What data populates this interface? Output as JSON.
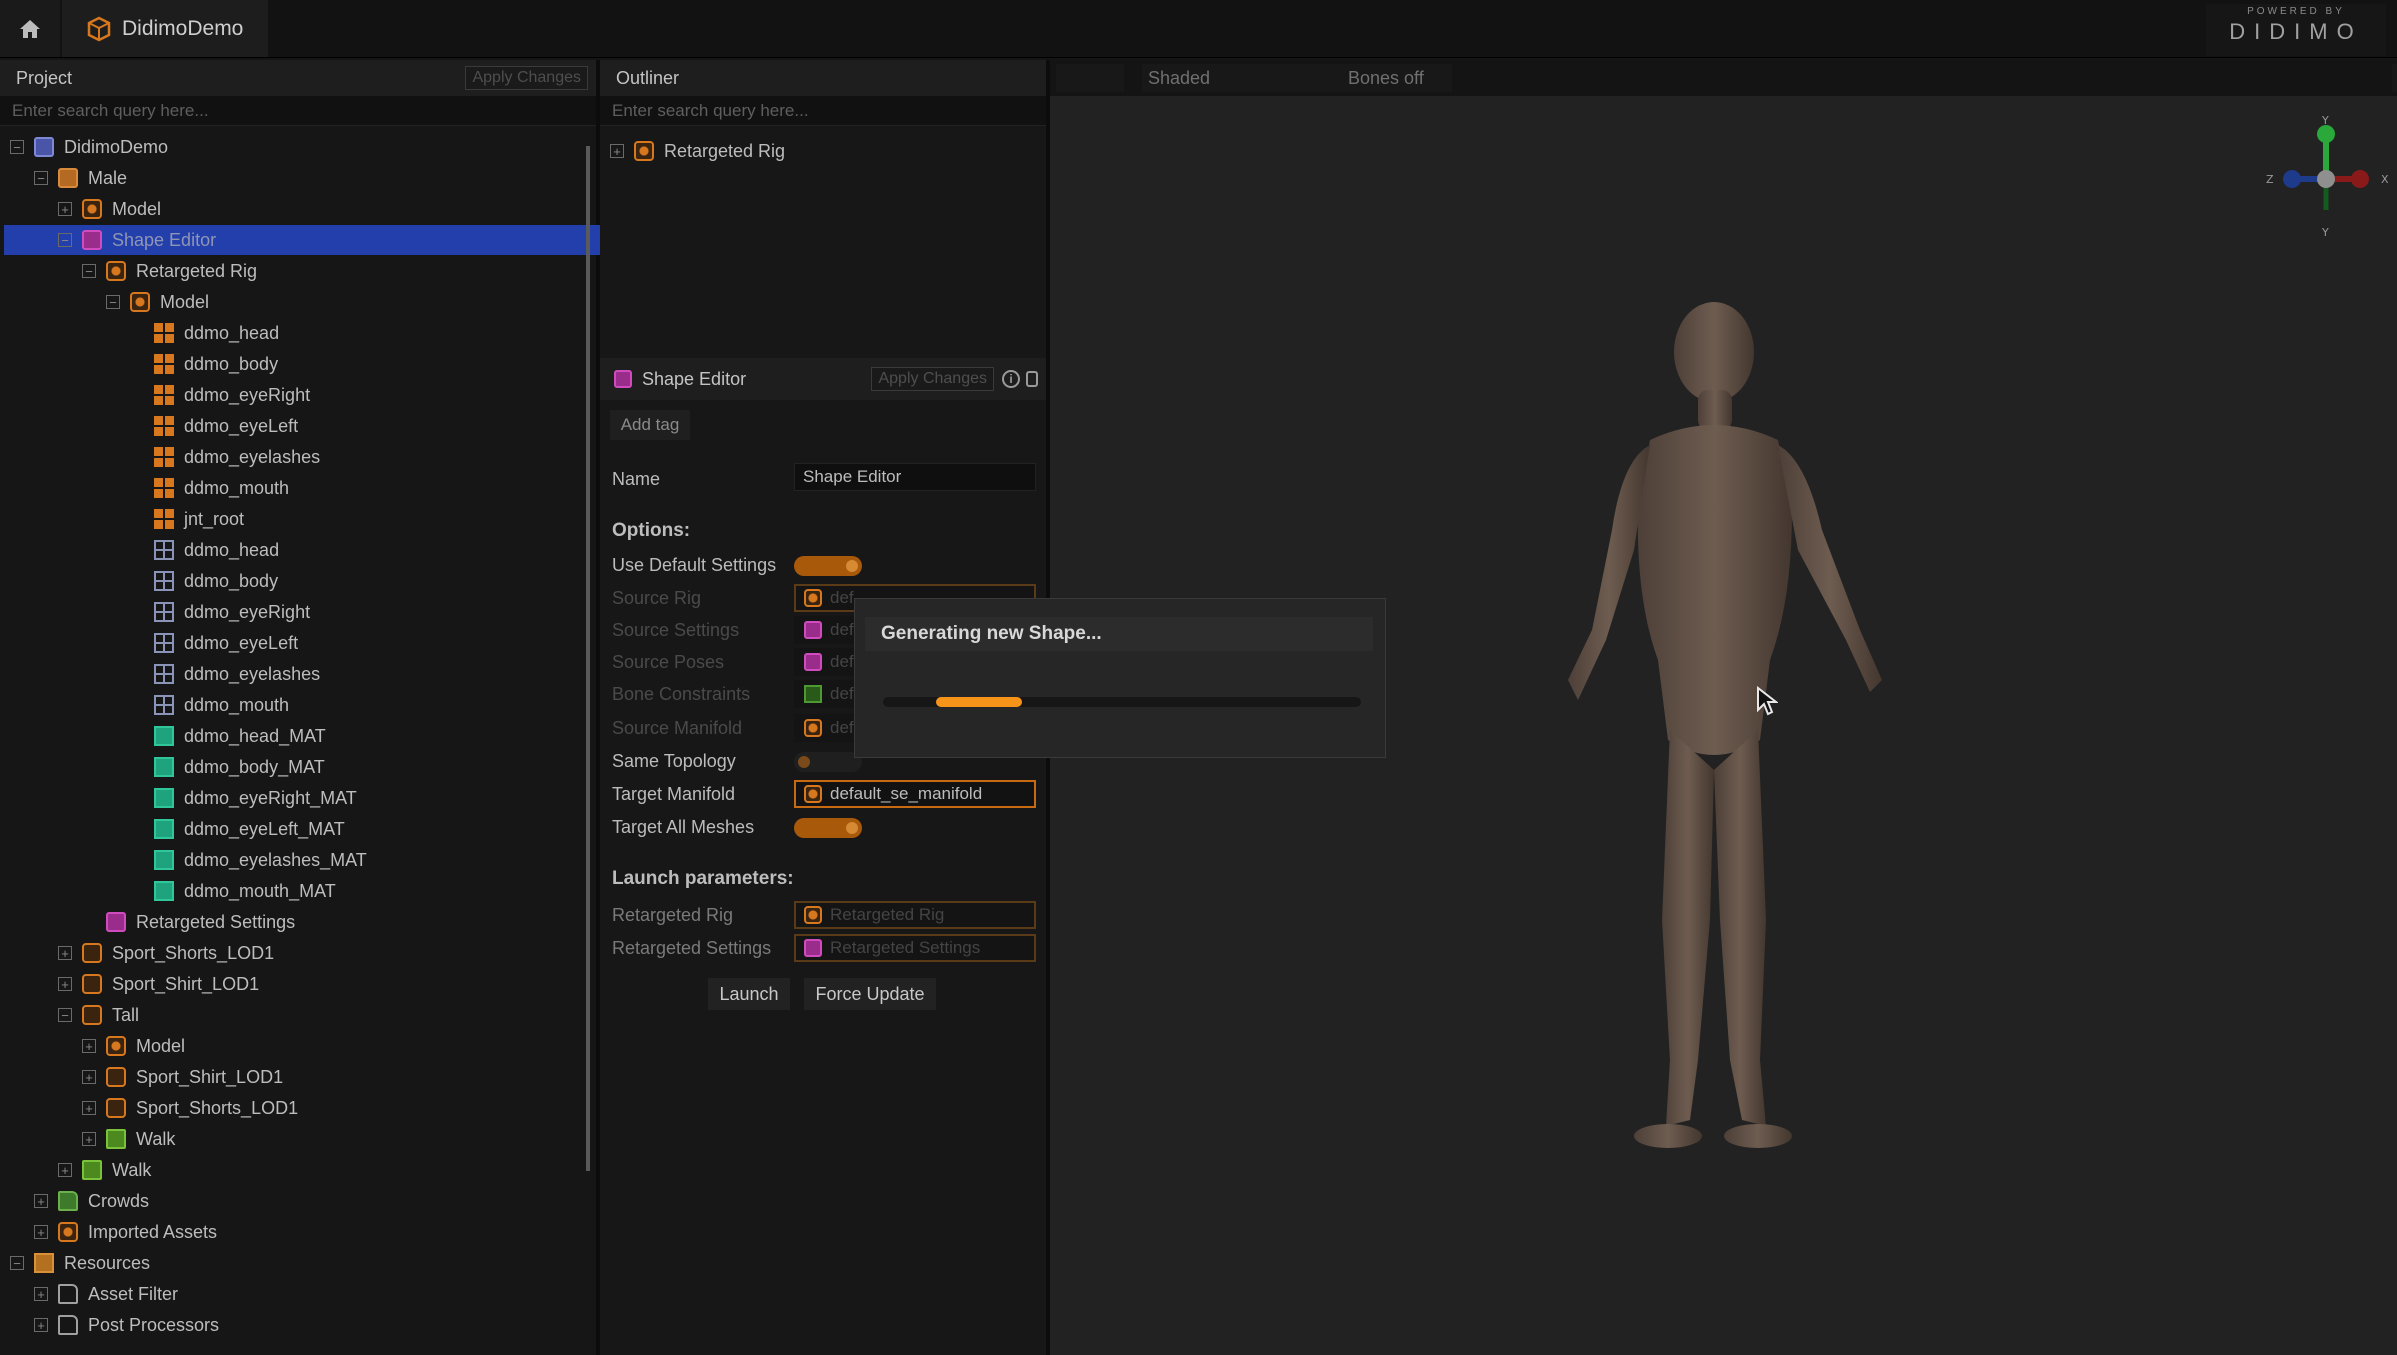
{
  "app": {
    "title": "DidimoDemo",
    "logo_top": "POWERED BY",
    "logo_main": "DIDIMO"
  },
  "project": {
    "title": "Project",
    "apply_label": "Apply Changes",
    "search_placeholder": "Enter search query here...",
    "tree": [
      {
        "label": "DidimoDemo",
        "indent": 0,
        "exp": "-",
        "icon": "ic-pb",
        "icon_name": "project-icon"
      },
      {
        "label": "Male",
        "indent": 1,
        "exp": "-",
        "icon": "ic-face",
        "icon_name": "character-icon"
      },
      {
        "label": "Model",
        "indent": 2,
        "exp": "+",
        "icon": "ic-orange-c",
        "icon_name": "model-icon"
      },
      {
        "label": "Shape Editor",
        "indent": 2,
        "exp": "-",
        "icon": "ic-pink",
        "icon_name": "shape-editor-icon",
        "selected": true
      },
      {
        "label": "Retargeted Rig",
        "indent": 3,
        "exp": "-",
        "icon": "ic-orange-c",
        "icon_name": "rig-icon"
      },
      {
        "label": "Model",
        "indent": 4,
        "exp": "-",
        "icon": "ic-orange-c",
        "icon_name": "model-icon"
      },
      {
        "label": "ddmo_head",
        "indent": 5,
        "exp": "",
        "icon": "ic-grid-o",
        "icon_name": "mesh-icon"
      },
      {
        "label": "ddmo_body",
        "indent": 5,
        "exp": "",
        "icon": "ic-grid-o",
        "icon_name": "mesh-icon"
      },
      {
        "label": "ddmo_eyeRight",
        "indent": 5,
        "exp": "",
        "icon": "ic-grid-o",
        "icon_name": "mesh-icon"
      },
      {
        "label": "ddmo_eyeLeft",
        "indent": 5,
        "exp": "",
        "icon": "ic-grid-o",
        "icon_name": "mesh-icon"
      },
      {
        "label": "ddmo_eyelashes",
        "indent": 5,
        "exp": "",
        "icon": "ic-grid-o",
        "icon_name": "mesh-icon"
      },
      {
        "label": "ddmo_mouth",
        "indent": 5,
        "exp": "",
        "icon": "ic-grid-o",
        "icon_name": "mesh-icon"
      },
      {
        "label": "jnt_root",
        "indent": 5,
        "exp": "",
        "icon": "ic-grid-o",
        "icon_name": "joint-icon"
      },
      {
        "label": "ddmo_head",
        "indent": 5,
        "exp": "",
        "icon": "ic-grid-b",
        "icon_name": "geometry-icon"
      },
      {
        "label": "ddmo_body",
        "indent": 5,
        "exp": "",
        "icon": "ic-grid-b",
        "icon_name": "geometry-icon"
      },
      {
        "label": "ddmo_eyeRight",
        "indent": 5,
        "exp": "",
        "icon": "ic-grid-b",
        "icon_name": "geometry-icon"
      },
      {
        "label": "ddmo_eyeLeft",
        "indent": 5,
        "exp": "",
        "icon": "ic-grid-b",
        "icon_name": "geometry-icon"
      },
      {
        "label": "ddmo_eyelashes",
        "indent": 5,
        "exp": "",
        "icon": "ic-grid-b",
        "icon_name": "geometry-icon"
      },
      {
        "label": "ddmo_mouth",
        "indent": 5,
        "exp": "",
        "icon": "ic-grid-b",
        "icon_name": "geometry-icon"
      },
      {
        "label": "ddmo_head_MAT",
        "indent": 5,
        "exp": "",
        "icon": "ic-mat",
        "icon_name": "material-icon"
      },
      {
        "label": "ddmo_body_MAT",
        "indent": 5,
        "exp": "",
        "icon": "ic-mat",
        "icon_name": "material-icon"
      },
      {
        "label": "ddmo_eyeRight_MAT",
        "indent": 5,
        "exp": "",
        "icon": "ic-mat",
        "icon_name": "material-icon"
      },
      {
        "label": "ddmo_eyeLeft_MAT",
        "indent": 5,
        "exp": "",
        "icon": "ic-mat",
        "icon_name": "material-icon"
      },
      {
        "label": "ddmo_eyelashes_MAT",
        "indent": 5,
        "exp": "",
        "icon": "ic-mat",
        "icon_name": "material-icon"
      },
      {
        "label": "ddmo_mouth_MAT",
        "indent": 5,
        "exp": "",
        "icon": "ic-mat",
        "icon_name": "material-icon"
      },
      {
        "label": "Retargeted Settings",
        "indent": 3,
        "exp": "",
        "icon": "ic-pink",
        "icon_name": "settings-icon"
      },
      {
        "label": "Sport_Shorts_LOD1",
        "indent": 2,
        "exp": "+",
        "icon": "ic-orange",
        "icon_name": "clothing-icon"
      },
      {
        "label": "Sport_Shirt_LOD1",
        "indent": 2,
        "exp": "+",
        "icon": "ic-orange",
        "icon_name": "clothing-icon"
      },
      {
        "label": "Tall",
        "indent": 2,
        "exp": "-",
        "icon": "ic-orange",
        "icon_name": "variant-icon"
      },
      {
        "label": "Model",
        "indent": 3,
        "exp": "+",
        "icon": "ic-orange-c",
        "icon_name": "model-icon"
      },
      {
        "label": "Sport_Shirt_LOD1",
        "indent": 3,
        "exp": "+",
        "icon": "ic-orange",
        "icon_name": "clothing-icon"
      },
      {
        "label": "Sport_Shorts_LOD1",
        "indent": 3,
        "exp": "+",
        "icon": "ic-orange",
        "icon_name": "clothing-icon"
      },
      {
        "label": "Walk",
        "indent": 3,
        "exp": "+",
        "icon": "ic-green",
        "icon_name": "animation-icon"
      },
      {
        "label": "Walk",
        "indent": 2,
        "exp": "+",
        "icon": "ic-green",
        "icon_name": "animation-icon"
      },
      {
        "label": "Crowds",
        "indent": 1,
        "exp": "+",
        "icon": "ic-folder-g",
        "icon_name": "folder-icon"
      },
      {
        "label": "Imported Assets",
        "indent": 1,
        "exp": "+",
        "icon": "ic-orange-c",
        "icon_name": "imported-assets-icon"
      },
      {
        "label": "Resources",
        "indent": 0,
        "exp": "-",
        "icon": "ic-res",
        "icon_name": "resources-icon"
      },
      {
        "label": "Asset Filter",
        "indent": 1,
        "exp": "+",
        "icon": "ic-folder",
        "icon_name": "folder-icon"
      },
      {
        "label": "Post Processors",
        "indent": 1,
        "exp": "+",
        "icon": "ic-folder",
        "icon_name": "folder-icon"
      }
    ]
  },
  "outliner": {
    "title": "Outliner",
    "search_placeholder": "Enter search query here...",
    "item": "Retargeted Rig"
  },
  "inspector": {
    "title": "Shape Editor",
    "apply_label": "Apply Changes",
    "add_tag": "Add tag",
    "name_label": "Name",
    "name_value": "Shape Editor",
    "options_label": "Options:",
    "use_default_settings": "Use Default Settings",
    "source_rig": "Source Rig",
    "source_settings": "Source Settings",
    "source_poses": "Source Poses",
    "bone_constraints": "Bone Constraints",
    "source_manifold": "Source Manifold",
    "dim_field_value": "def",
    "same_topology": "Same Topology",
    "target_manifold": "Target Manifold",
    "target_manifold_value": "default_se_manifold",
    "target_all_meshes": "Target All Meshes",
    "launch_params": "Launch parameters:",
    "retargeted_rig_label": "Retargeted Rig",
    "retargeted_rig_value": "Retargeted Rig",
    "retargeted_settings_label": "Retargeted Settings",
    "retargeted_settings_value": "Retargeted Settings",
    "launch_btn": "Launch",
    "force_update_btn": "Force Update"
  },
  "viewport": {
    "shading": "Shaded",
    "bones": "Bones off",
    "axis_y": "Y",
    "axis_z": "Z",
    "axis_x": "X",
    "axis_neg_y": "Y"
  },
  "dialog": {
    "message": "Generating new Shape...",
    "progress_start": 0.11,
    "progress_end": 0.29
  },
  "colors": {
    "accent": "#f59418",
    "selection": "#233fab"
  }
}
